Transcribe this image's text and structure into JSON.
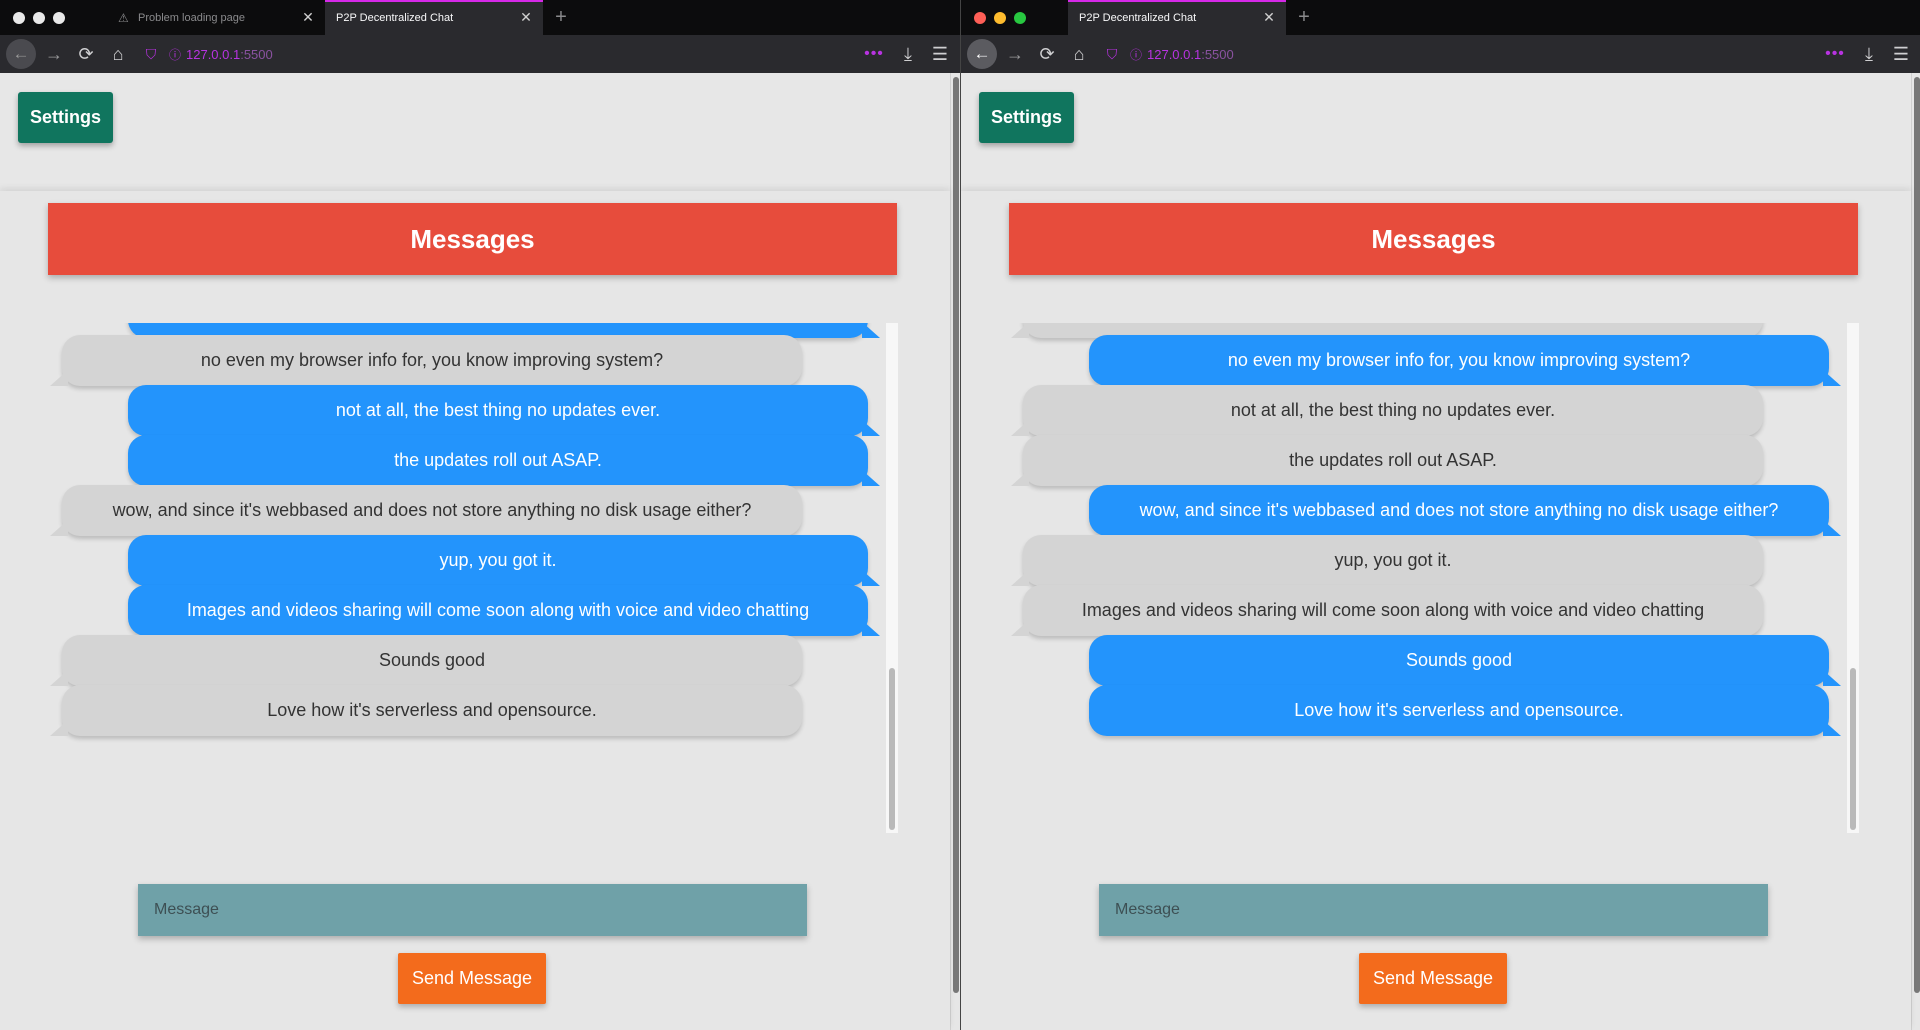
{
  "left_window": {
    "tabs": [
      {
        "title": "Problem loading page"
      },
      {
        "title": "P2P Decentralized Chat"
      }
    ],
    "url": {
      "host": "127.0.0.1",
      "port": ":5500"
    },
    "settings_label": "Settings",
    "header_title": "Messages",
    "messages": [
      {
        "text": "no even my browser info for, you know improving system?",
        "from": "other"
      },
      {
        "text": "not at all, the best thing no updates ever.",
        "from": "me"
      },
      {
        "text": "the updates roll out ASAP.",
        "from": "me"
      },
      {
        "text": "wow, and since it's webbased and does not store anything no disk usage either?",
        "from": "other"
      },
      {
        "text": "yup, you got it.",
        "from": "me"
      },
      {
        "text": "Images and videos sharing will come soon along with voice and video chatting",
        "from": "me"
      },
      {
        "text": "Sounds good",
        "from": "other"
      },
      {
        "text": "Love how it's serverless and opensource.",
        "from": "other"
      }
    ],
    "input_placeholder": "Message",
    "send_label": "Send Message"
  },
  "right_window": {
    "tabs": [
      {
        "title": "P2P Decentralized Chat"
      }
    ],
    "url": {
      "host": "127.0.0.1",
      "port": ":5500"
    },
    "settings_label": "Settings",
    "header_title": "Messages",
    "messages": [
      {
        "text": "no even my browser info for, you know improving system?",
        "from": "me"
      },
      {
        "text": "not at all, the best thing no updates ever.",
        "from": "other"
      },
      {
        "text": "the updates roll out ASAP.",
        "from": "other"
      },
      {
        "text": "wow, and since it's webbased and does not store anything no disk usage either?",
        "from": "me"
      },
      {
        "text": "yup, you got it.",
        "from": "other"
      },
      {
        "text": "Images and videos sharing will come soon along with voice and video chatting",
        "from": "other"
      },
      {
        "text": "Sounds good",
        "from": "me"
      },
      {
        "text": "Love how it's serverless and opensource.",
        "from": "me"
      }
    ],
    "input_placeholder": "Message",
    "send_label": "Send Message"
  },
  "colors": {
    "settings_green": "#10755e",
    "header_red": "#e74c3c",
    "bubble_blue": "#2394fc",
    "bubble_gray": "#d4d4d4",
    "input_teal": "#6fa1a8",
    "send_orange": "#f36b1c",
    "tab_accent": "#d629e8"
  }
}
